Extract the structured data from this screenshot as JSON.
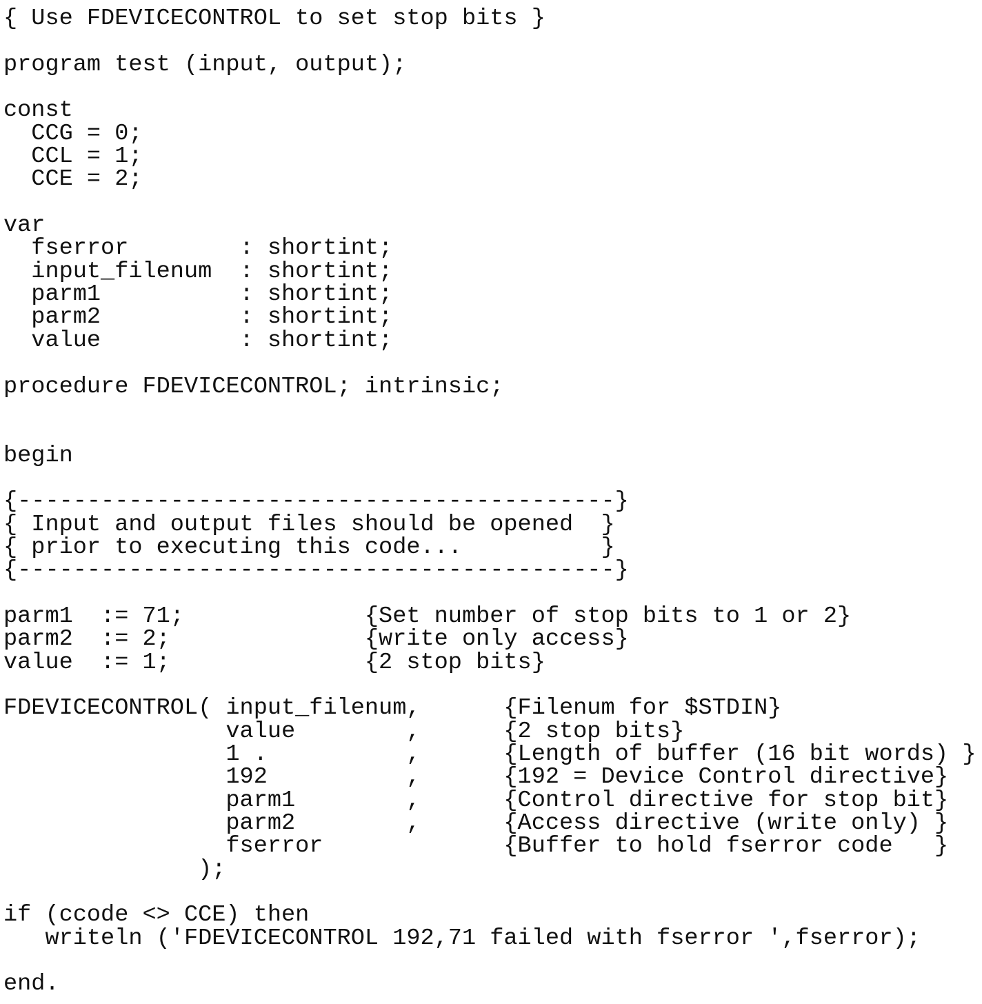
{
  "document": {
    "language": "Pascal",
    "lines": [
      "{ Use FDEVICECONTROL to set stop bits }",
      "",
      "program test (input, output);",
      "",
      "const",
      "  CCG = 0;",
      "  CCL = 1;",
      "  CCE = 2;",
      "",
      "var",
      "  fserror        : shortint;",
      "  input_filenum  : shortint;",
      "  parm1          : shortint;",
      "  parm2          : shortint;",
      "  value          : shortint;",
      "",
      "procedure FDEVICECONTROL; intrinsic;",
      "",
      "",
      "begin",
      "",
      "{-------------------------------------------}",
      "{ Input and output files should be opened  }",
      "{ prior to executing this code...          }",
      "{-------------------------------------------}",
      "",
      "parm1  := 71;             {Set number of stop bits to 1 or 2}",
      "parm2  := 2;              {write only access}",
      "value  := 1;              {2 stop bits}",
      "",
      "FDEVICECONTROL( input_filenum,      {Filenum for $STDIN}",
      "                value        ,      {2 stop bits}",
      "                1 .          ,      {Length of buffer (16 bit words) }",
      "                192          ,      {192 = Device Control directive}",
      "                parm1        ,      {Control directive for stop bit}",
      "                parm2        ,      {Access directive (write only) }",
      "                fserror             {Buffer to hold fserror code   }",
      "              );",
      "",
      "if (ccode <> CCE) then",
      "   writeln ('FDEVICECONTROL 192,71 failed with fserror ',fserror);",
      "",
      "end."
    ]
  }
}
